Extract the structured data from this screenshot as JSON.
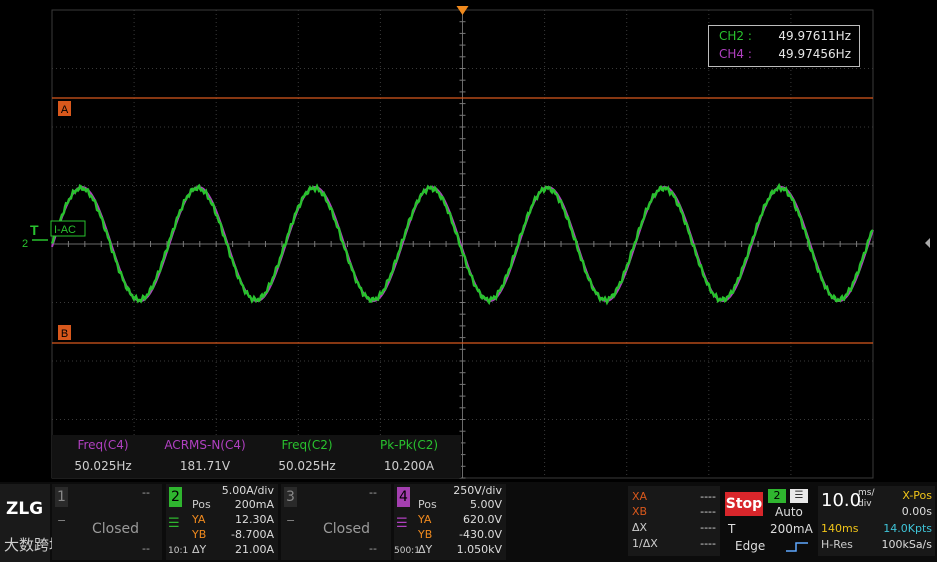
{
  "display": {
    "marker_a": "A",
    "marker_b": "B",
    "trigger_marker": "T",
    "ch2_marker": "2",
    "trigger_label": "I-AC",
    "colors": {
      "ch2": "#29c22e",
      "ch4": "#b040c0",
      "cursor": "#d8581c",
      "trigger": "#f08a1e"
    }
  },
  "frequency_counter": [
    {
      "channel": "CH2 :",
      "value": "49.97611Hz"
    },
    {
      "channel": "CH4 :",
      "value": "49.97456Hz"
    }
  ],
  "measurements": [
    {
      "name": "Freq(C4)",
      "value": "50.025Hz"
    },
    {
      "name": "ACRMS-N(C4)",
      "value": "181.71V"
    },
    {
      "name": "Freq(C2)",
      "value": "50.025Hz"
    },
    {
      "name": "Pk-Pk(C2)",
      "value": "10.200A"
    }
  ],
  "brand": {
    "logo": "ZLG",
    "watermark": "大数跨境"
  },
  "channels": {
    "ch1": {
      "number": "1",
      "dash1": "--",
      "dash2": "--",
      "state": "Closed"
    },
    "ch2": {
      "number": "2",
      "scale": "5.00A/div",
      "pos_label": "Pos",
      "pos": "200mA",
      "ya_label": "YA",
      "ya": "12.30A",
      "yb_label": "YB",
      "yb": "-8.700A",
      "dy_label": "ΔY",
      "dy": "21.00A",
      "probe": "10:1"
    },
    "ch3": {
      "number": "3",
      "dash1": "--",
      "dash2": "--",
      "state": "Closed"
    },
    "ch4": {
      "number": "4",
      "scale": "250V/div",
      "pos_label": "Pos",
      "pos": "5.00V",
      "ya_label": "YA",
      "ya": "620.0V",
      "yb_label": "YB",
      "yb": "-430.0V",
      "dy_label": "ΔY",
      "dy": "1.050kV",
      "probe": "500:1"
    }
  },
  "cursors": {
    "xa_label": "XA",
    "xa": "----",
    "xb_label": "XB",
    "xb": "----",
    "dx_label": "ΔX",
    "dx": "----",
    "inv_label": "1/ΔX",
    "inv": "----"
  },
  "trigger": {
    "state": "Stop",
    "source": "2",
    "mode": "Auto",
    "t_label": "T",
    "level": "200mA",
    "type": "Edge"
  },
  "timebase": {
    "scale": "10.0",
    "unit_top": "ms/",
    "unit_bottom": "div",
    "xpos_label": "X-Pos",
    "xpos": "0.00s",
    "record": "140ms",
    "points": "14.0Kpts",
    "hres_label": "H-Res",
    "sample_rate": "100kSa/s"
  }
}
